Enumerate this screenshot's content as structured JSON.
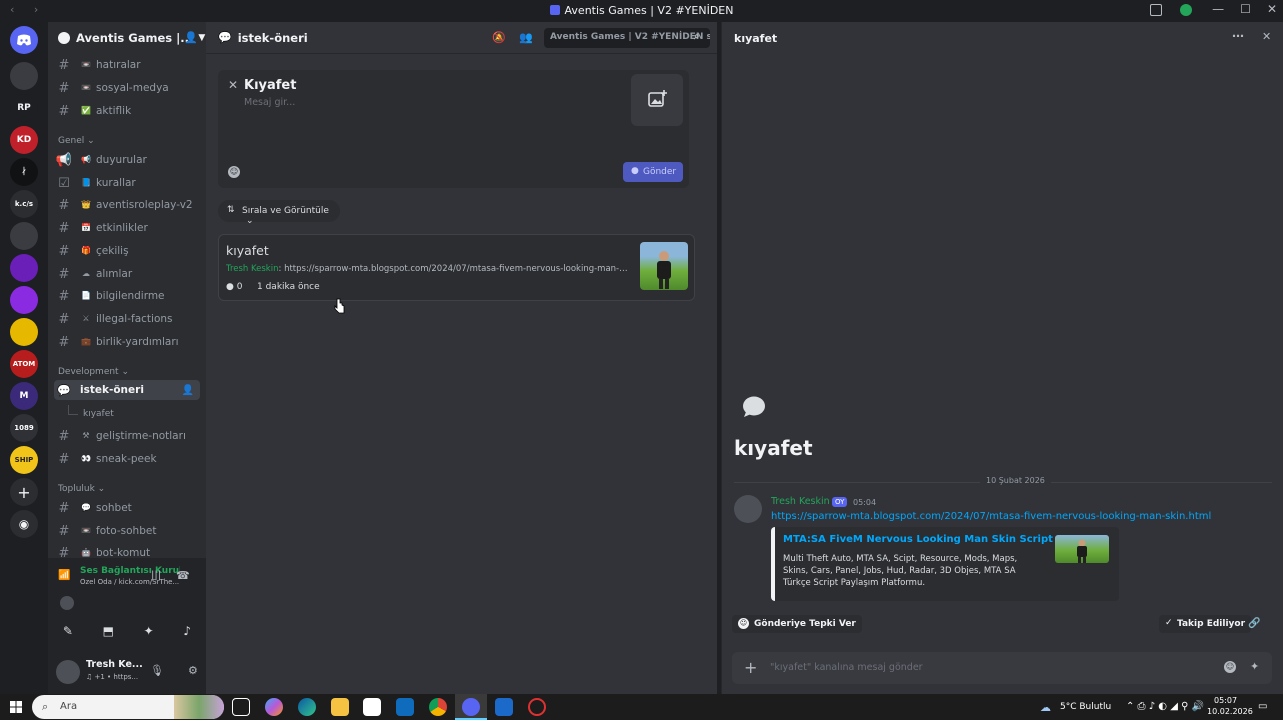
{
  "window": {
    "title": "Aventis Games | V2 #YENİDEN",
    "controls": [
      "—",
      "☐",
      "✕"
    ]
  },
  "rail": {
    "servers": [
      {
        "label": "",
        "color": "#5865f2"
      },
      {
        "label": "",
        "color": "#2b2d31"
      },
      {
        "label": "RP",
        "color": "#1e1f22"
      },
      {
        "label": "KD",
        "color": "#c0202a"
      },
      {
        "label": "ᛅ",
        "color": "#111214"
      },
      {
        "label": "k.c/s",
        "color": "#2b2d31"
      },
      {
        "label": "",
        "color": "#3a3c42"
      },
      {
        "label": "",
        "color": "#6a1fb8"
      },
      {
        "label": "",
        "color": "#8a2be2"
      },
      {
        "label": "",
        "color": "#e6b800"
      },
      {
        "label": "ATOM",
        "color": "#b81d1d"
      },
      {
        "label": "M",
        "color": "#3b2a7a"
      },
      {
        "label": "1089",
        "color": "#2f3136"
      },
      {
        "label": "SHIP",
        "color": "#f0c419"
      }
    ]
  },
  "sidebar": {
    "server_name": "Aventis Games |...",
    "channels_top": [
      {
        "emoji": "📼",
        "name": "hatıralar"
      },
      {
        "emoji": "📼",
        "name": "sosyal-medya"
      },
      {
        "emoji": "✅",
        "name": "aktiflik"
      }
    ],
    "cat_general": "Genel",
    "channels_general": [
      {
        "emoji": "📢",
        "name": "duyurular"
      },
      {
        "emoji": "📘",
        "name": "kurallar"
      },
      {
        "emoji": "👑",
        "name": "aventisroleplay-v2"
      },
      {
        "emoji": "📅",
        "name": "etkinlikler"
      },
      {
        "emoji": "🎁",
        "name": "çekiliş"
      },
      {
        "emoji": "☁",
        "name": "alımlar"
      },
      {
        "emoji": "📄",
        "name": "bilgilendirme"
      },
      {
        "emoji": "⚔",
        "name": "illegal-factions"
      },
      {
        "emoji": "💼",
        "name": "birlik-yardımları"
      }
    ],
    "cat_dev": "Development",
    "active_forum": "istek-öneri",
    "active_thread": "kıyafet",
    "channels_dev": [
      {
        "emoji": "⚒",
        "name": "geliştirme-notları"
      },
      {
        "emoji": "👀",
        "name": "sneak-peek"
      }
    ],
    "cat_community": "Topluluk",
    "channels_community": [
      {
        "emoji": "💬",
        "name": "sohbet"
      },
      {
        "emoji": "📼",
        "name": "foto-sohbet"
      },
      {
        "emoji": "🤖",
        "name": "bot-komut"
      }
    ],
    "voice": {
      "status": "Ses Bağlantısı Kuruldu",
      "detail": "Özel Oda / kick.com/SrThe..."
    },
    "user": {
      "name": "Tresh Ke...",
      "status": "♫ +1 • https..."
    }
  },
  "forum": {
    "channel_name": "istek-öneri",
    "search_placeholder": "Aventis Games | V2 #YENİDEN s...",
    "composer": {
      "title": "Kıyafet",
      "placeholder": "Mesaj gir...",
      "send_label": "Gönder"
    },
    "sort_label": "Sırala ve Görüntüle",
    "post": {
      "title": "kıyafet",
      "author": "Tresh Keskin",
      "preview": "https://sparrow-mta.blogspot.com/2024/07/mtasa-fivem-nervous-looking-man-skin...",
      "comment_count": "0",
      "age": "1 dakika önce"
    }
  },
  "thread": {
    "header_title": "kıyafet",
    "big_title": "kıyafet",
    "date": "10 Şubat 2026",
    "message": {
      "author": "Tresh Keskin",
      "tag": "OY",
      "time": "05:04",
      "link": "https://sparrow-mta.blogspot.com/2024/07/mtasa-fivem-nervous-looking-man-skin.html",
      "embed_title": "MTA:SA FiveM Nervous Looking Man Skin Script",
      "embed_desc": "Multi Theft Auto, MTA SA, Scipt, Resource, Mods, Maps, Skins, Cars, Panel, Jobs, Hud, Radar, 3D Objes, MTA SA Türkçe Script Paylaşım Platformu."
    },
    "react_label": "Gönderiye Tepki Ver",
    "follow_label": "Takip Ediliyor",
    "input_placeholder": "\"kıyafet\" kanalına mesaj gönder"
  },
  "taskbar": {
    "search_label": "Ara",
    "weather": "5°C  Bulutlu",
    "time": "05:07",
    "date": "10.02.2026"
  },
  "colors": {
    "accent": "#5865f2",
    "online_green": "#23a55a",
    "link": "#00a8fc"
  }
}
